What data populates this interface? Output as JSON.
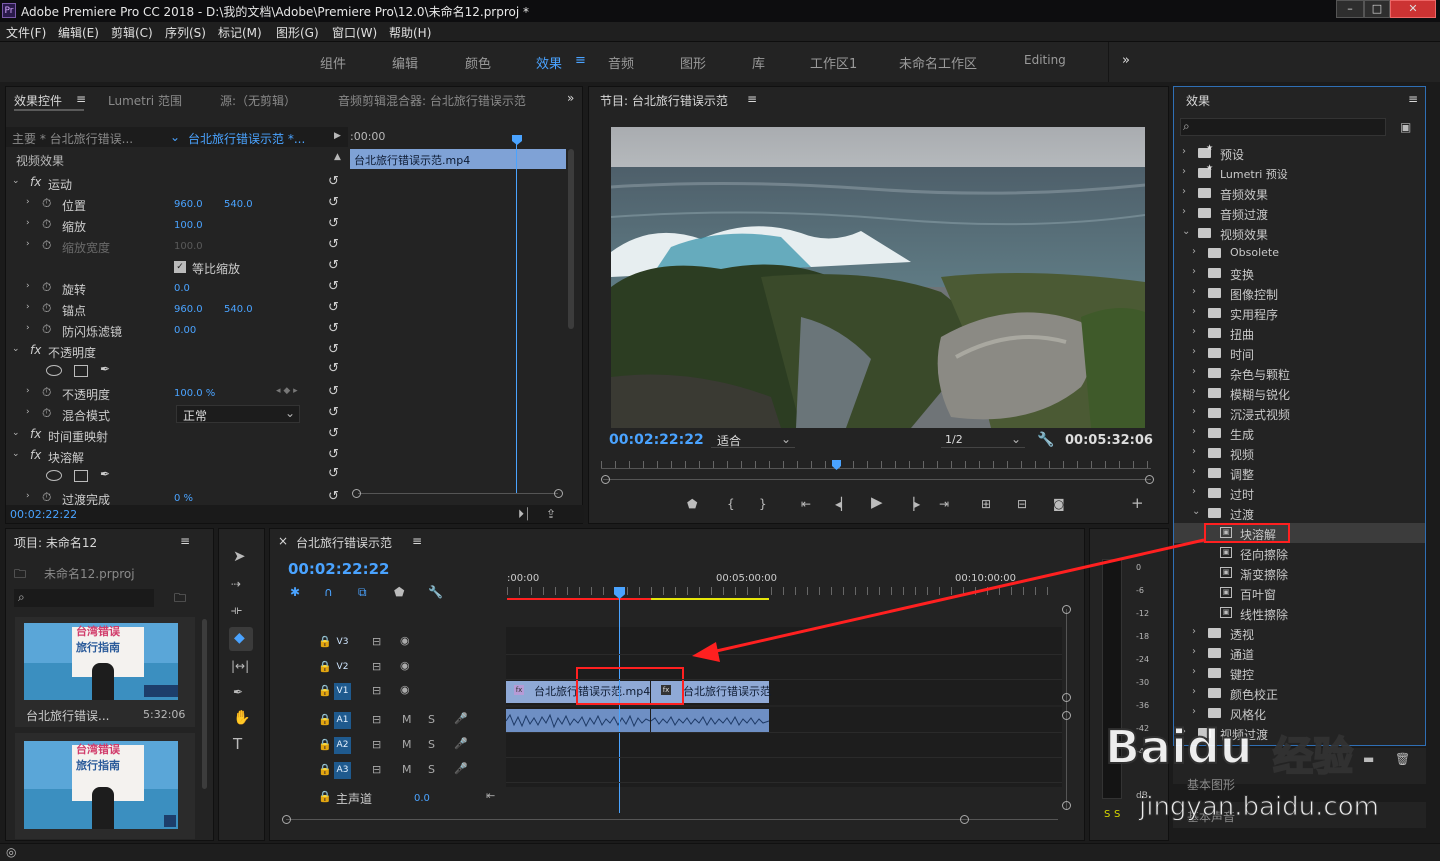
{
  "titlebar": {
    "icon": "Pr",
    "title": "Adobe Premiere Pro CC 2018 - D:\\我的文档\\Adobe\\Premiere Pro\\12.0\\未命名12.prproj *",
    "min": "–",
    "max": "□",
    "close": "✕"
  },
  "menu": [
    "文件(F)",
    "编辑(E)",
    "剪辑(C)",
    "序列(S)",
    "标记(M)",
    "图形(G)",
    "窗口(W)",
    "帮助(H)"
  ],
  "workspaces": [
    "组件",
    "编辑",
    "颜色",
    "效果",
    "音频",
    "图形",
    "库",
    "工作区1",
    "未命名工作区",
    "Editing"
  ],
  "workspace_overflow": "»",
  "effect_controls": {
    "tabs": [
      "效果控件",
      "Lumetri 范围",
      "源:（无剪辑）",
      "音频剪辑混合器: 台北旅行错误示范"
    ],
    "overflow": "»",
    "master": "主要 * 台北旅行错误...",
    "sequence": "台北旅行错误示范 *...",
    "timecode_start": ":00:00",
    "clip_name": "台北旅行错误示范.mp4",
    "section": "视频效果",
    "rows": [
      {
        "label": "运动",
        "type": "fx"
      },
      {
        "label": "位置",
        "v1": "960.0",
        "v2": "540.0"
      },
      {
        "label": "缩放",
        "v1": "100.0"
      },
      {
        "label": "缩放宽度",
        "v1": "100.0"
      },
      {
        "label": "等比缩放",
        "type": "check"
      },
      {
        "label": "旋转",
        "v1": "0.0"
      },
      {
        "label": "锚点",
        "v1": "960.0",
        "v2": "540.0"
      },
      {
        "label": "防闪烁滤镜",
        "v1": "0.00"
      },
      {
        "label": "不透明度",
        "type": "fx"
      },
      {
        "label": "不透明度",
        "v1": "100.0 %"
      },
      {
        "label": "混合模式",
        "v1": "正常"
      },
      {
        "label": "时间重映射",
        "type": "fx"
      },
      {
        "label": "块溶解",
        "type": "fx"
      },
      {
        "label": "过渡完成",
        "v1": "0 %"
      }
    ],
    "timecode": "00:02:22:22"
  },
  "program": {
    "title": "节目: 台北旅行错误示范",
    "timecode": "00:02:22:22",
    "fit": "适合",
    "quality": "1/2",
    "duration": "00:05:32:06"
  },
  "effects_panel": {
    "title": "效果",
    "search_placeholder": "",
    "items": [
      {
        "label": "预设",
        "level": 0,
        "kind": "folder-star"
      },
      {
        "label": "Lumetri 预设",
        "level": 0,
        "kind": "folder-star"
      },
      {
        "label": "音频效果",
        "level": 0,
        "kind": "folder"
      },
      {
        "label": "音频过渡",
        "level": 0,
        "kind": "folder"
      },
      {
        "label": "视频效果",
        "level": 0,
        "kind": "folder",
        "open": true
      },
      {
        "label": "Obsolete",
        "level": 1,
        "kind": "folder"
      },
      {
        "label": "变换",
        "level": 1,
        "kind": "folder"
      },
      {
        "label": "图像控制",
        "level": 1,
        "kind": "folder"
      },
      {
        "label": "实用程序",
        "level": 1,
        "kind": "folder"
      },
      {
        "label": "扭曲",
        "level": 1,
        "kind": "folder"
      },
      {
        "label": "时间",
        "level": 1,
        "kind": "folder"
      },
      {
        "label": "杂色与颗粒",
        "level": 1,
        "kind": "folder"
      },
      {
        "label": "模糊与锐化",
        "level": 1,
        "kind": "folder"
      },
      {
        "label": "沉浸式视频",
        "level": 1,
        "kind": "folder"
      },
      {
        "label": "生成",
        "level": 1,
        "kind": "folder"
      },
      {
        "label": "视频",
        "level": 1,
        "kind": "folder"
      },
      {
        "label": "调整",
        "level": 1,
        "kind": "folder"
      },
      {
        "label": "过时",
        "level": 1,
        "kind": "folder"
      },
      {
        "label": "过渡",
        "level": 1,
        "kind": "folder",
        "open": true
      },
      {
        "label": "块溶解",
        "level": 2,
        "kind": "effect",
        "selected": true
      },
      {
        "label": "径向擦除",
        "level": 2,
        "kind": "effect"
      },
      {
        "label": "渐变擦除",
        "level": 2,
        "kind": "effect"
      },
      {
        "label": "百叶窗",
        "level": 2,
        "kind": "effect"
      },
      {
        "label": "线性擦除",
        "level": 2,
        "kind": "effect"
      },
      {
        "label": "透视",
        "level": 1,
        "kind": "folder"
      },
      {
        "label": "通道",
        "level": 1,
        "kind": "folder"
      },
      {
        "label": "键控",
        "level": 1,
        "kind": "folder"
      },
      {
        "label": "颜色校正",
        "level": 1,
        "kind": "folder"
      },
      {
        "label": "风格化",
        "level": 1,
        "kind": "folder"
      },
      {
        "label": "视频过渡",
        "level": 0,
        "kind": "folder"
      }
    ],
    "footer_items": [
      "基本图形",
      "基本声音"
    ]
  },
  "project": {
    "title": "项目: 未命名12",
    "file": "未命名12.prproj",
    "clips": [
      {
        "name": "台北旅行错误...",
        "duration": "5:32:06",
        "thumb_line1": "台湾错误",
        "thumb_line2": "旅行指南"
      },
      {
        "name": "",
        "duration": "",
        "thumb_line1": "台湾错误",
        "thumb_line2": "旅行指南"
      }
    ]
  },
  "timeline": {
    "title": "台北旅行错误示范",
    "timecode": "00:02:22:22",
    "ruler": [
      ":00:00",
      "00:05:00:00",
      "00:10:00:00"
    ],
    "tracks": [
      {
        "name": "V3",
        "kind": "video"
      },
      {
        "name": "V2",
        "kind": "video"
      },
      {
        "name": "V1",
        "kind": "video",
        "active": true
      },
      {
        "name": "A1",
        "kind": "audio",
        "active": true
      },
      {
        "name": "A2",
        "kind": "audio",
        "active": true
      },
      {
        "name": "A3",
        "kind": "audio",
        "active": true
      }
    ],
    "master": "主声道",
    "master_value": "0.0",
    "clip1": "台北旅行错误示范.mp4",
    "clip2": "台北旅行错误示范"
  },
  "meter": {
    "scale": [
      "0",
      "-6",
      "-12",
      "-18",
      "-24",
      "-30",
      "-36",
      "-42",
      "-48"
    ],
    "unit": "dB",
    "labels": [
      "S",
      "S"
    ]
  },
  "watermark": {
    "brand": "Baidu",
    "cn": "经验",
    "url": "jingyan.baidu.com"
  },
  "colors": {
    "accent": "#4aa3ff",
    "highlight": "#ff2020",
    "panel": "#232323",
    "clip_video": "#8fa9d6",
    "clip_audio": "#6e8fc4"
  }
}
